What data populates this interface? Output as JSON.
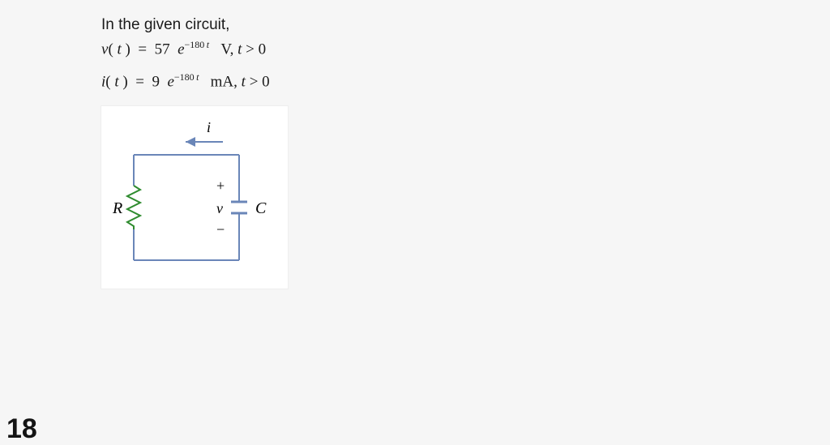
{
  "problem": {
    "lead": "In the given circuit,",
    "eq1": {
      "lhs_var": "v",
      "lhs_arg": "t",
      "coef": "57",
      "base": "e",
      "exp": "−180",
      "exp_var": "t",
      "unit": "V",
      "cond_var": "t",
      "cond": "> 0"
    },
    "eq2": {
      "lhs_var": "i",
      "lhs_arg": "t",
      "coef": "9",
      "base": "e",
      "exp": "−180",
      "exp_var": "t",
      "unit": "mA",
      "cond_var": "t",
      "cond": "> 0"
    }
  },
  "diagram": {
    "labels": {
      "current": "i",
      "R": "R",
      "C": "C",
      "v": "v",
      "plus": "+",
      "minus": "−"
    }
  },
  "page_hint": "18"
}
